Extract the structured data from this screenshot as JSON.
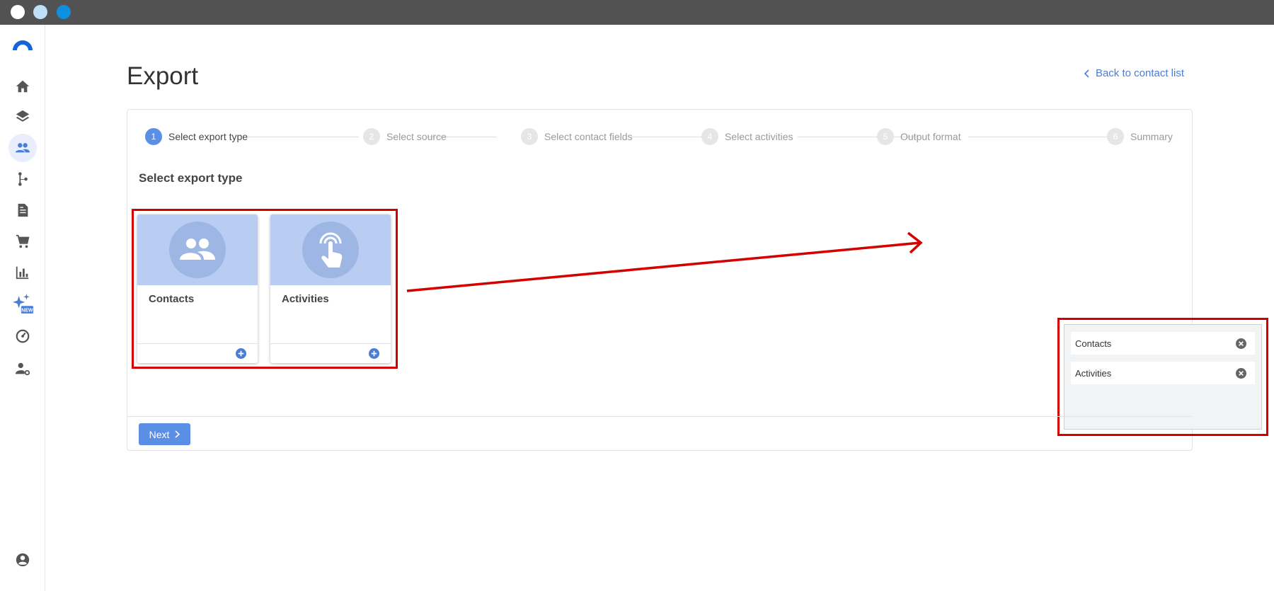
{
  "page": {
    "title": "Export",
    "back_link": "Back to contact list"
  },
  "sidebar": {
    "items": [
      {
        "name": "home",
        "icon": "home-icon"
      },
      {
        "name": "layers",
        "icon": "layers-icon"
      },
      {
        "name": "contacts",
        "icon": "people-icon",
        "active": true
      },
      {
        "name": "flows",
        "icon": "branch-icon"
      },
      {
        "name": "documents",
        "icon": "document-icon"
      },
      {
        "name": "shop",
        "icon": "cart-icon"
      },
      {
        "name": "reports",
        "icon": "bar-chart-icon"
      },
      {
        "name": "ai",
        "icon": "sparkle-icon",
        "badge": "NEW"
      },
      {
        "name": "dashboard",
        "icon": "gauge-icon"
      },
      {
        "name": "user-settings",
        "icon": "user-gear-icon"
      }
    ],
    "bottom_icon": "account-circle-icon"
  },
  "stepper": {
    "steps": [
      {
        "num": "1",
        "label": "Select export type"
      },
      {
        "num": "2",
        "label": "Select source"
      },
      {
        "num": "3",
        "label": "Select contact fields"
      },
      {
        "num": "4",
        "label": "Select activities"
      },
      {
        "num": "5",
        "label": "Output format"
      },
      {
        "num": "6",
        "label": "Summary"
      }
    ],
    "active_step": 1
  },
  "section": {
    "title": "Select export type"
  },
  "tiles": [
    {
      "label": "Contacts",
      "icon": "people-icon"
    },
    {
      "label": "Activities",
      "icon": "touch-icon"
    }
  ],
  "selected": [
    {
      "label": "Contacts"
    },
    {
      "label": "Activities"
    }
  ],
  "footer": {
    "next_label": "Next"
  },
  "colors": {
    "accent": "#5b8fe6",
    "annotation": "#d40000",
    "tile_header": "#b9cdf2"
  }
}
